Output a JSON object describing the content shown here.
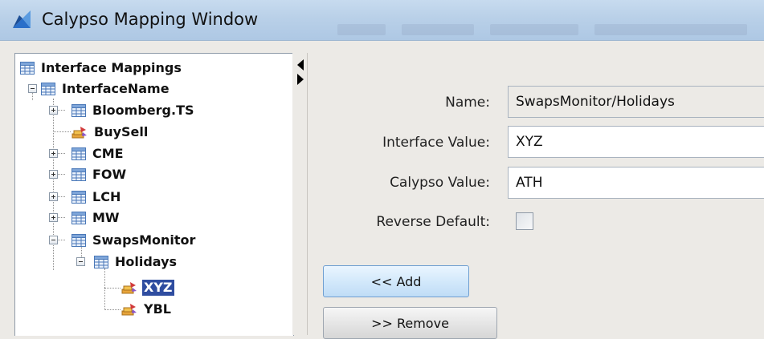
{
  "window": {
    "title": "Calypso Mapping Window"
  },
  "tree": {
    "root": "Interface Mappings",
    "nodes": [
      {
        "label": "InterfaceName",
        "icon": "table-icon",
        "expanded": true
      },
      {
        "label": "Bloomberg.TS",
        "icon": "table-icon",
        "expanded": false
      },
      {
        "label": "BuySell",
        "icon": "mapping-leaf-icon"
      },
      {
        "label": "CME",
        "icon": "table-icon",
        "expanded": false
      },
      {
        "label": "FOW",
        "icon": "table-icon",
        "expanded": false
      },
      {
        "label": "LCH",
        "icon": "table-icon",
        "expanded": false
      },
      {
        "label": "MW",
        "icon": "table-icon",
        "expanded": false
      },
      {
        "label": "SwapsMonitor",
        "icon": "table-icon",
        "expanded": true
      },
      {
        "label": "Holidays",
        "icon": "table-icon",
        "expanded": true
      },
      {
        "label": "XYZ",
        "icon": "mapping-leaf-icon",
        "selected": true
      },
      {
        "label": "YBL",
        "icon": "mapping-leaf-icon"
      }
    ]
  },
  "form": {
    "name_label": "Name:",
    "name_value": "SwapsMonitor/Holidays",
    "interface_value_label": "Interface Value:",
    "interface_value": "XYZ",
    "calypso_value_label": "Calypso Value:",
    "calypso_value": "ATH",
    "reverse_default_label": "Reverse Default:",
    "reverse_default_checked": false
  },
  "buttons": {
    "add_label": "<< Add",
    "remove_label": ">> Remove"
  },
  "colors": {
    "selection": "#2f4da0",
    "titlebar": "#b9d0e8",
    "panel_bg": "#eceae6"
  }
}
